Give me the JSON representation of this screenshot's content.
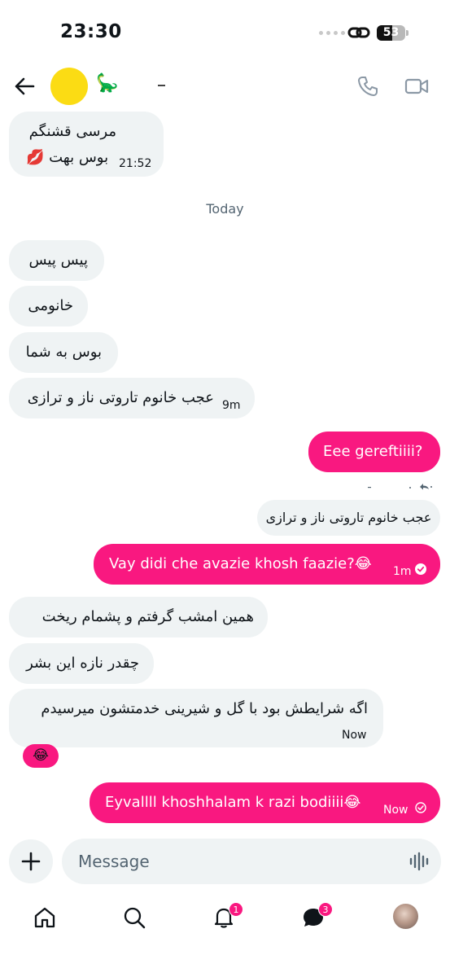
{
  "status_bar": {
    "time": "23:30",
    "battery": "53",
    "battery_level": 0.53
  },
  "header": {
    "contact_emoji": "🦕"
  },
  "messages_before_today": [
    {
      "line1": "مرسی قشنگم",
      "line2": "بوس بهت 💋",
      "time": "21:52"
    }
  ],
  "day_separator": "Today",
  "incoming_1": [
    {
      "text": "پیس پیس"
    },
    {
      "text": "خانومی"
    },
    {
      "text": "بوس به شما"
    },
    {
      "text": "عجب خانوم تاروتی ناز و ترازی",
      "time": "9m"
    }
  ],
  "outgoing_1": {
    "text": "Eee gereftiiii?"
  },
  "reply_quote": {
    "text": "عجب خانوم تاروتی ناز و ترازی"
  },
  "outgoing_2": {
    "text": "Vay didi che avazie khosh faazie?😂",
    "time": "1m"
  },
  "incoming_2": [
    {
      "text": "همین امشب گرفتم و پشمام ریخت"
    },
    {
      "text": "چقدر نازه این بشر"
    },
    {
      "text": "اگه شرایطش بود با گل و شیرینی خدمتشون میرسیدم",
      "time": "Now"
    }
  ],
  "reaction": "😂",
  "outgoing_3": {
    "text": "Eyvallll khoshhalam k razi bodiiii😂",
    "time": "Now"
  },
  "composer": {
    "placeholder": "Message"
  },
  "nav": {
    "notifications_badge": "1",
    "messages_badge": "3"
  },
  "colors": {
    "accent": "#f91880",
    "bubble_in": "#eff3f4",
    "text": "#0f1419",
    "muted": "#536471"
  }
}
